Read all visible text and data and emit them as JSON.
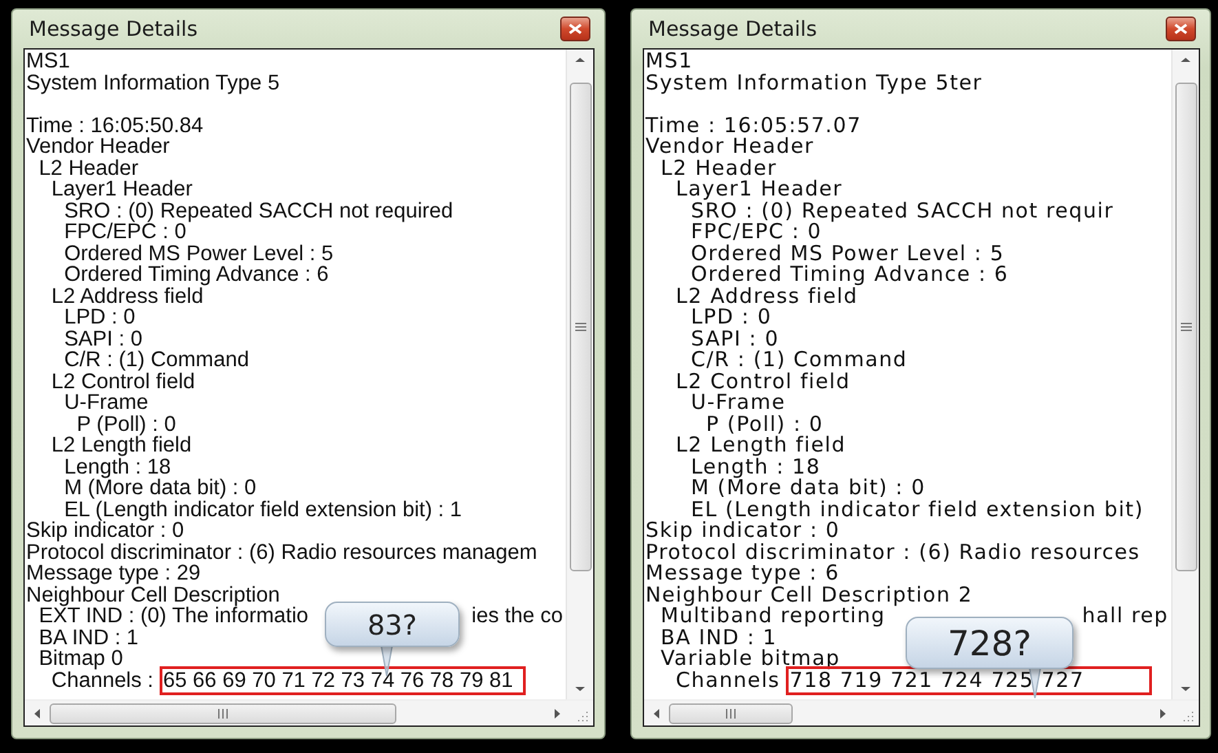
{
  "windows": [
    {
      "title": "Message Details",
      "heading": [
        "MS1",
        "System Information Type 5"
      ],
      "tree": [
        {
          "text": "Time : 16:05:50.84"
        },
        {
          "text": "Vendor Header",
          "children": [
            {
              "text": "L2 Header",
              "children": [
                {
                  "text": "Layer1 Header",
                  "children": [
                    {
                      "text": "SRO : (0) Repeated SACCH not required"
                    },
                    {
                      "text": "FPC/EPC : 0"
                    },
                    {
                      "text": "Ordered MS Power Level : 5"
                    },
                    {
                      "text": "Ordered Timing Advance : 6"
                    }
                  ]
                },
                {
                  "text": "L2 Address field",
                  "children": [
                    {
                      "text": "LPD : 0"
                    },
                    {
                      "text": "SAPI : 0"
                    },
                    {
                      "text": "C/R : (1) Command"
                    }
                  ]
                },
                {
                  "text": "L2 Control field",
                  "children": [
                    {
                      "text": "U-Frame",
                      "children": [
                        {
                          "text": "P (Poll) : 0"
                        }
                      ]
                    }
                  ]
                },
                {
                  "text": "L2 Length field",
                  "children": [
                    {
                      "text": "Length : 18"
                    },
                    {
                      "text": "M (More data bit) : 0"
                    },
                    {
                      "text": "EL (Length indicator field extension bit) : 1"
                    }
                  ]
                }
              ]
            }
          ]
        },
        {
          "text": "Skip indicator : 0"
        },
        {
          "text": "Protocol discriminator : (6) Radio resources managem"
        },
        {
          "text": "Message type : 29"
        },
        {
          "text": "Neighbour Cell Description",
          "children": [
            {
              "text": "EXT IND : (0) The informatio",
              "tail": "ies the co"
            },
            {
              "text": "BA IND : 1"
            },
            {
              "text": "Bitmap 0",
              "children": [
                {
                  "text": "Channels :",
                  "value": "65 66 69 70 71 72 73 74 76 78 79 81",
                  "highlighted": true
                }
              ]
            }
          ]
        }
      ],
      "callout": "83?"
    },
    {
      "title": "Message Details",
      "heading": [
        "MS1",
        "System Information Type 5ter"
      ],
      "tree": [
        {
          "text": "Time : 16:05:57.07"
        },
        {
          "text": "Vendor Header",
          "children": [
            {
              "text": "L2 Header",
              "children": [
                {
                  "text": "Layer1 Header",
                  "children": [
                    {
                      "text": "SRO : (0) Repeated SACCH not requir"
                    },
                    {
                      "text": "FPC/EPC : 0"
                    },
                    {
                      "text": "Ordered MS Power Level : 5"
                    },
                    {
                      "text": "Ordered Timing Advance : 6"
                    }
                  ]
                },
                {
                  "text": "L2 Address field",
                  "children": [
                    {
                      "text": "LPD : 0"
                    },
                    {
                      "text": "SAPI : 0"
                    },
                    {
                      "text": "C/R : (1) Command"
                    }
                  ]
                },
                {
                  "text": "L2 Control field",
                  "children": [
                    {
                      "text": "U-Frame",
                      "children": [
                        {
                          "text": "P (Poll) : 0"
                        }
                      ]
                    }
                  ]
                },
                {
                  "text": "L2 Length field",
                  "children": [
                    {
                      "text": "Length : 18"
                    },
                    {
                      "text": "M (More data bit) : 0"
                    },
                    {
                      "text": "EL (Length indicator field extension bit)"
                    }
                  ]
                }
              ]
            }
          ]
        },
        {
          "text": "Skip indicator : 0"
        },
        {
          "text": "Protocol discriminator : (6) Radio resources"
        },
        {
          "text": "Message type : 6"
        },
        {
          "text": "Neighbour Cell Description 2",
          "children": [
            {
              "text": "Multiband reporting",
              "tail": "hall rep"
            },
            {
              "text": "BA IND : 1"
            },
            {
              "text": "Variable bitmap",
              "children": [
                {
                  "text": "Channels",
                  "value": "718 719 721 724 725 727",
                  "highlighted": true
                }
              ]
            }
          ]
        }
      ],
      "callout": "728?"
    }
  ]
}
